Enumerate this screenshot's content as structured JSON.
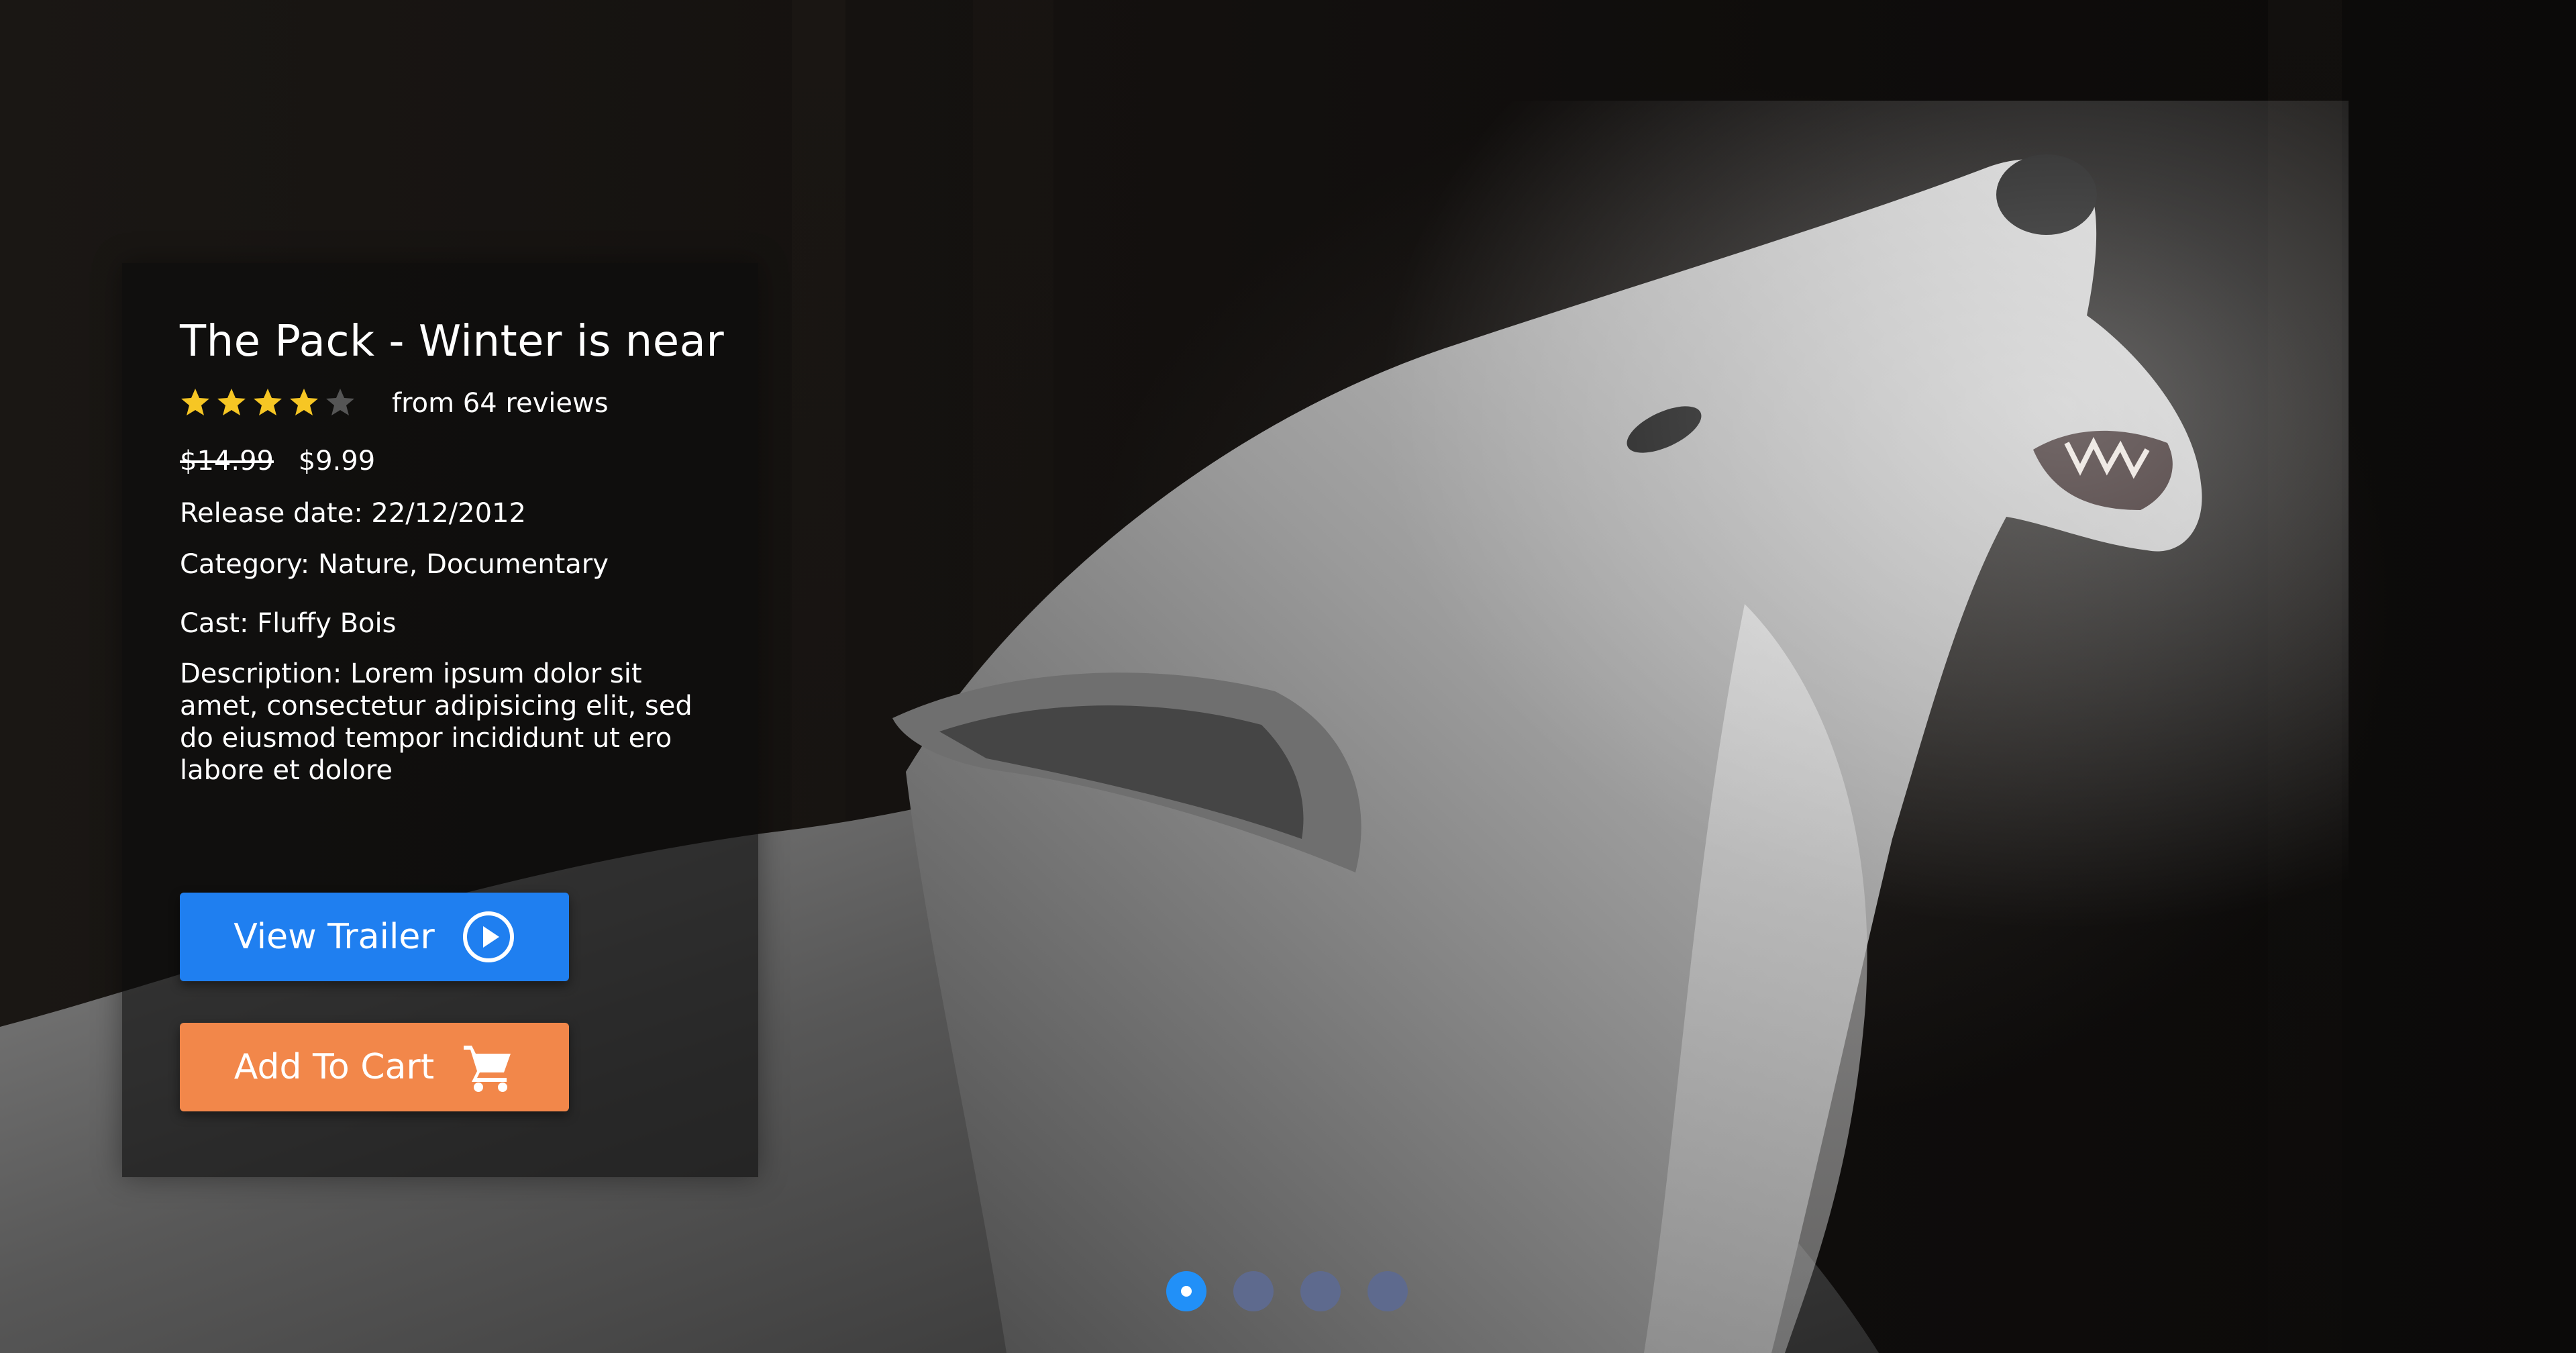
{
  "movie": {
    "title": "The Pack - Winter is near",
    "rating": 4,
    "rating_max": 5,
    "reviews_text": "from 64 reviews",
    "old_price": "$14.99",
    "price": "$9.99",
    "release_date": "Release date: 22/12/2012",
    "category": "Category: Nature, Documentary",
    "cast": "Cast: Fluffy Bois",
    "description": "Description: Lorem ipsum dolor sit amet, consectetur adipisicing elit, sed do eiusmod tempor incididunt ut ero labore et dolore"
  },
  "buttons": {
    "trailer_label": "View Trailer",
    "trailer_icon": "play-circle-icon",
    "cart_label": "Add To Cart",
    "cart_icon": "shopping-cart-icon"
  },
  "carousel": {
    "slide_count": 4,
    "active_index": 0
  },
  "colors": {
    "star_filled": "#f6c624",
    "star_empty": "#555555",
    "trailer_button": "#1f7ff0",
    "cart_button": "#f2874a",
    "dot_active": "#2190f8",
    "dot_inactive": "#5e6a8e"
  }
}
